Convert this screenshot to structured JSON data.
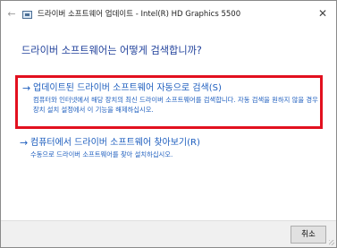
{
  "window": {
    "title": "드라이버 소프트웨어 업데이트 - Intel(R) HD Graphics 5500",
    "back_icon": "←",
    "close_icon": "✕"
  },
  "heading": "드라이버 소프트웨어는 어떻게 검색합니까?",
  "options": [
    {
      "arrow": "→",
      "title": "업데이트된 드라이버 소프트웨어 자동으로 검색(S)",
      "description": "컴퓨터와 인터넷에서 해당 장치의 최신 드라이버 소프트웨어를 검색합니다. 자동 검색을 원하지 않을 경우 장치 설치 설정에서 이 기능을 해제하십시오."
    },
    {
      "arrow": "→",
      "title": "컴퓨터에서 드라이버 소프트웨어 찾아보기(R)",
      "description": "수동으로 드라이버 소프트웨어를 찾아 설치하십시오."
    }
  ],
  "footer": {
    "cancel_label": "취소"
  },
  "colors": {
    "heading": "#1e3f9a",
    "link": "#1f5fbf",
    "highlight_box": "#e2101f"
  }
}
